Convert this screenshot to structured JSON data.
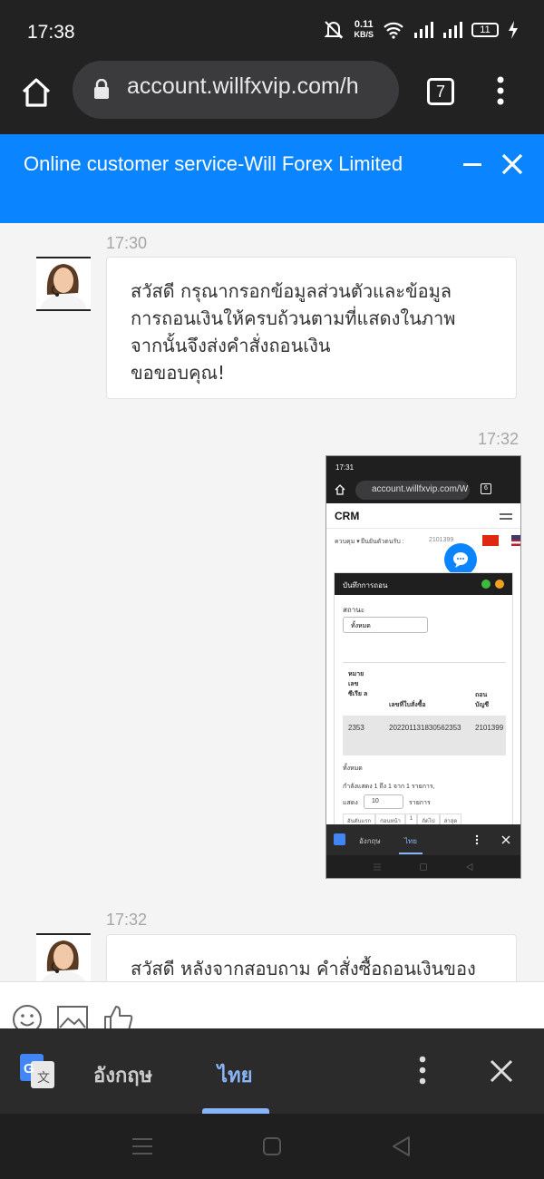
{
  "status_bar": {
    "time": "17:38",
    "net_speed_value": "0.11",
    "net_speed_unit": "KB/S",
    "battery": "11",
    "icons": [
      "mute-icon",
      "wifi-icon",
      "signal-icon",
      "signal-icon",
      "battery-icon",
      "charging-icon"
    ]
  },
  "browser": {
    "url": "account.willfxvip.com/h",
    "tab_count": "7"
  },
  "chat_header": {
    "title": "Online customer service-Will Forex Limited"
  },
  "messages": [
    {
      "time": "17:30",
      "sender": "agent",
      "lines": [
        "สวัสดี กรุณากรอกข้อมูลส่วนตัวและข้อมูล",
        "การถอนเงินให้ครบถ้วนตามที่แสดงในภาพ",
        "จากนั้นจึงส่งคำสั่งถอนเงิน",
        "ขอขอบคุณ!"
      ]
    },
    {
      "time": "17:32",
      "sender": "user",
      "type": "image"
    },
    {
      "time": "17:32",
      "sender": "agent",
      "lines": [
        "สวัสดี หลังจากสอบถาม คำสั่งซื้อถอนเงินของ"
      ]
    }
  ],
  "attached_screenshot": {
    "time": "17:31",
    "url": "account.willfxvip.com/W",
    "tab_count": "6",
    "brand": "CRM",
    "nav_left": "ควบคุม ▾",
    "nav_mid": "ยืนยันตัวตนรับ :",
    "account": "2101399",
    "panel_title": "บันทึกการถอน",
    "status_label": "สถานะ",
    "status_value": "ทั้งหมด",
    "table": {
      "headers": [
        "หมาย เลข ซีเรีย ล",
        "เลขที่ใบสั่งซื้อ",
        "ถอน บัญชี"
      ],
      "row": [
        "2353",
        "202201131830562353",
        "2101399"
      ]
    },
    "total_label": "ทั้งหมด",
    "showing": "กำลังแสดง 1 ถึง 1 จาก 1 รายการ,",
    "show_label": "แสดง",
    "page_size": "10",
    "items_label": "รายการ",
    "pagination": [
      "อันดับแรก",
      "ก่อนหน้า",
      "1",
      "ถัดไป",
      "ล่าสุด"
    ],
    "translate_from": "อังกฤษ",
    "translate_to": "ไทย"
  },
  "composer": {
    "icons": [
      "emoji-icon",
      "image-icon",
      "thumbs-up-icon"
    ]
  },
  "translate_bar": {
    "from_lang": "อังกฤษ",
    "to_lang": "ไทย"
  },
  "colors": {
    "accent": "#0a84ff",
    "dark": "#222222",
    "translate_selected": "#8ab4f8"
  }
}
